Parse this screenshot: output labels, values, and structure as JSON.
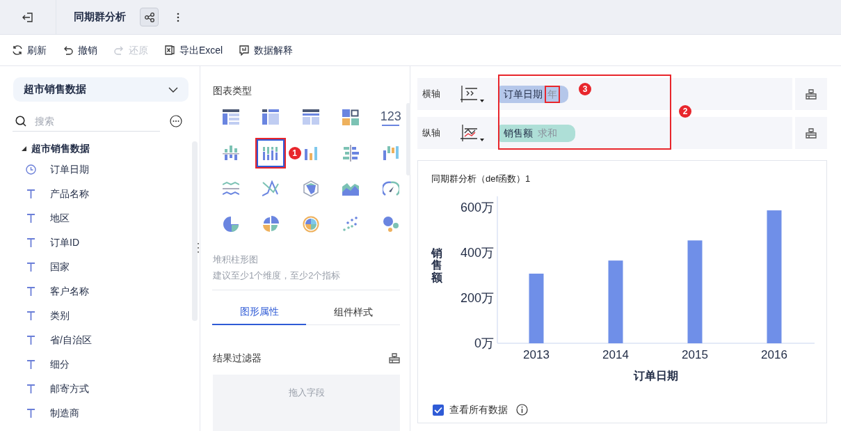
{
  "header": {
    "title": "同期群分析"
  },
  "toolbar": [
    {
      "label": "刷新",
      "kind": "refresh",
      "disabled": false
    },
    {
      "label": "撤销",
      "kind": "undo",
      "disabled": false
    },
    {
      "label": "还原",
      "kind": "redo",
      "disabled": true
    },
    {
      "label": "导出Excel",
      "kind": "excel",
      "disabled": false
    },
    {
      "label": "数据解释",
      "kind": "explain",
      "disabled": false
    }
  ],
  "sidebar": {
    "dataset": "超市销售数据",
    "search": {
      "placeholder": "搜索"
    },
    "tree": [
      {
        "label": "超市销售数据",
        "expanded": true,
        "children": [
          {
            "label": "订单日期",
            "kind": "date"
          },
          {
            "label": "产品名称",
            "kind": "text"
          },
          {
            "label": "地区",
            "kind": "text"
          },
          {
            "label": "订单ID",
            "kind": "text"
          },
          {
            "label": "国家",
            "kind": "text"
          },
          {
            "label": "客户名称",
            "kind": "text"
          },
          {
            "label": "类别",
            "kind": "text"
          },
          {
            "label": "省/自治区",
            "kind": "text"
          },
          {
            "label": "细分",
            "kind": "text"
          },
          {
            "label": "邮寄方式",
            "kind": "text"
          },
          {
            "label": "制造商",
            "kind": "text"
          }
        ]
      }
    ]
  },
  "chart_types": {
    "title": "图表类型",
    "items": [
      {
        "kind": "detail-table",
        "selected": false
      },
      {
        "kind": "group-table",
        "selected": false
      },
      {
        "kind": "cross-table",
        "selected": false
      },
      {
        "kind": "blocks",
        "selected": false
      },
      {
        "kind": "number",
        "glyph": "123",
        "selected": false
      },
      {
        "kind": "diverging-bar",
        "selected": false
      },
      {
        "kind": "stacked-bar",
        "selected": true,
        "badge": "1"
      },
      {
        "kind": "multi-bar",
        "selected": false
      },
      {
        "kind": "horizontal-bar",
        "selected": false
      },
      {
        "kind": "range-bar",
        "selected": false
      },
      {
        "kind": "wave",
        "selected": false
      },
      {
        "kind": "cross-line",
        "selected": false
      },
      {
        "kind": "radar",
        "selected": false
      },
      {
        "kind": "area",
        "selected": false
      },
      {
        "kind": "gauge",
        "selected": false
      },
      {
        "kind": "pie",
        "selected": false
      },
      {
        "kind": "rose",
        "selected": false
      },
      {
        "kind": "sunburst",
        "selected": false
      },
      {
        "kind": "scatter",
        "selected": false
      },
      {
        "kind": "bubble",
        "selected": false
      }
    ],
    "name": "堆积柱形图",
    "hint": "建议至少1个维度，至少2个指标"
  },
  "tabs": [
    {
      "label": "图形属性",
      "selected": true
    },
    {
      "label": "组件样式",
      "selected": false
    }
  ],
  "filter": {
    "title": "结果过滤器",
    "drop_hint": "拖入字段"
  },
  "axes": [
    {
      "label": "横轴",
      "kind": "x",
      "field": {
        "name": "订单日期",
        "agg": "年",
        "kind": "dimension"
      }
    },
    {
      "label": "纵轴",
      "kind": "y",
      "field": {
        "name": "销售额",
        "agg": "求和",
        "kind": "measure"
      }
    }
  ],
  "axes_badge": "2",
  "agg_badge": "3",
  "chart": {
    "title": "同期群分析（def函数）1",
    "chart_data": {
      "type": "bar",
      "xlabel": "订单日期",
      "ylabel": "销售额",
      "categories": [
        "2013",
        "2014",
        "2015",
        "2016"
      ],
      "series": [
        {
          "color": "#6f8fe8",
          "values": [
            308,
            366,
            455,
            588
          ]
        }
      ],
      "ylim": [
        0,
        650
      ],
      "yticks": [
        {
          "value": 0,
          "label": "0万"
        },
        {
          "value": 200,
          "label": "200万"
        },
        {
          "value": 400,
          "label": "400万"
        },
        {
          "value": 600,
          "label": "600万"
        }
      ]
    },
    "show_all": {
      "label": "查看所有数据",
      "checked": true
    }
  }
}
